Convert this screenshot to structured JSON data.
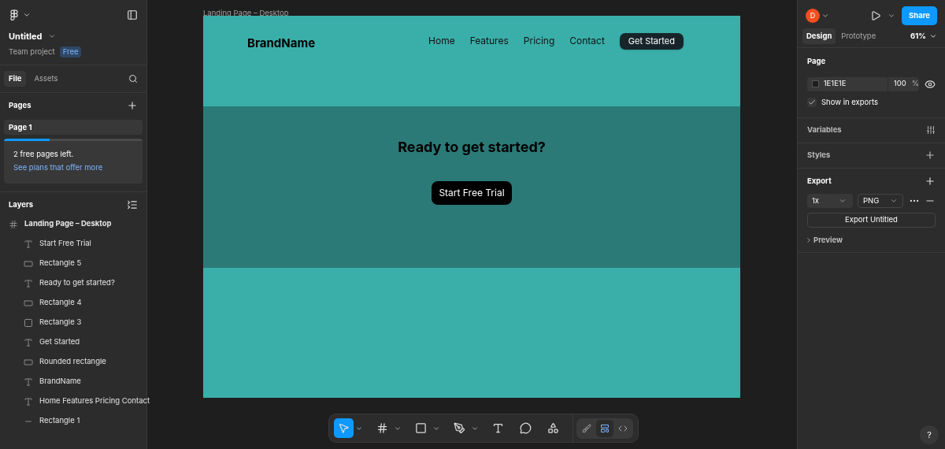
{
  "file": {
    "name": "Untitled",
    "project": "Team project",
    "plan": "Free"
  },
  "left_tabs": [
    {
      "label": "File",
      "selected": true
    },
    {
      "label": "Assets",
      "selected": false
    }
  ],
  "pages": {
    "title": "Pages",
    "items": [
      {
        "label": "Page 1",
        "selected": true
      }
    ],
    "notice": {
      "level": 0.33,
      "text": "2 free pages left.",
      "link": "See plans that offer more"
    }
  },
  "layers": {
    "title": "Layers",
    "items": [
      {
        "label": "Landing Page – Desktop",
        "kind": "frame",
        "children": [
          {
            "label": "Start Free Trial",
            "kind": "text"
          },
          {
            "label": "Rectangle 5",
            "kind": "rectangle-wide"
          },
          {
            "label": "Ready to get started?",
            "kind": "text"
          },
          {
            "label": "Rectangle 4",
            "kind": "rectangle-wide"
          },
          {
            "label": "Rectangle 3",
            "kind": "rectangle-tall"
          },
          {
            "label": "Get Started",
            "kind": "text"
          },
          {
            "label": "Rounded rectangle",
            "kind": "rectangle-wide"
          },
          {
            "label": "BrandName",
            "kind": "text"
          },
          {
            "label": "Home Features Pricing Contact",
            "kind": "text"
          },
          {
            "label": "Rectangle 1",
            "kind": "line"
          }
        ]
      }
    ]
  },
  "canvas": {
    "frame_label": "Landing Page – Desktop",
    "brand": "BrandName",
    "nav": [
      "Home",
      "Features",
      "Pricing",
      "Contact"
    ],
    "nav_button": "Get Started",
    "heading": "Ready to get started?",
    "cta": "Start Free Trial"
  },
  "toolbar": {
    "tools": [
      {
        "kind": "move",
        "selected": true,
        "menu": true
      },
      {
        "kind": "frame",
        "selected": false,
        "menu": true
      },
      {
        "kind": "shape",
        "selected": false,
        "menu": true
      },
      {
        "kind": "pen",
        "selected": false,
        "menu": true
      },
      {
        "kind": "text",
        "selected": false,
        "menu": false
      },
      {
        "kind": "comment",
        "selected": false,
        "menu": false
      },
      {
        "kind": "actions",
        "selected": false,
        "menu": false
      }
    ],
    "modes": [
      {
        "kind": "draw",
        "selected": false
      },
      {
        "kind": "design",
        "selected": true
      },
      {
        "kind": "dev",
        "selected": false
      }
    ]
  },
  "header_right": {
    "avatar": "D",
    "share": "Share",
    "zoom": "61%"
  },
  "right_tabs": [
    {
      "label": "Design",
      "selected": true
    },
    {
      "label": "Prototype",
      "selected": false
    }
  ],
  "page_section": {
    "title": "Page",
    "color_hex": "1E1E1E",
    "opacity": "100",
    "unit": "%",
    "show_in_exports": {
      "label": "Show in exports",
      "checked": true
    }
  },
  "variables": "Variables",
  "styles": "Styles",
  "export": {
    "title": "Export",
    "scale": "1x",
    "format": "PNG",
    "button": "Export Untitled",
    "preview": "Preview"
  },
  "help": "?"
}
